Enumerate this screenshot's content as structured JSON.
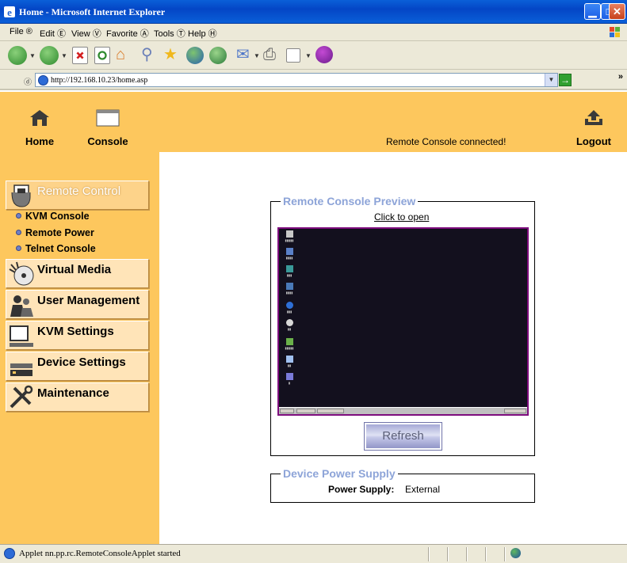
{
  "window": {
    "title": "Home - Microsoft Internet Explorer",
    "minimize": "▁",
    "maximize": "□",
    "close": "✕"
  },
  "menu": {
    "items": [
      "File ® ",
      "Edit Ⓔ ",
      "View Ⓥ ",
      "Favorite Ⓐ ",
      "Tools Ⓣ ",
      "Help Ⓗ "
    ]
  },
  "address": {
    "label": "ⓓ",
    "url": "http://192.168.10.23/home.asp",
    "go": "→",
    "more": "»"
  },
  "topnav": {
    "home": "Home",
    "console": "Console",
    "logout": "Logout",
    "status": "Remote Console connected!"
  },
  "sidebar": {
    "remote_control": "Remote Control",
    "sub_items": [
      "KVM Console",
      "Remote Power",
      "Telnet Console"
    ],
    "virtual_media": "Virtual Media",
    "user_management": "User Management",
    "kvm_settings": "KVM Settings",
    "device_settings": "Device Settings",
    "maintenance": "Maintenance"
  },
  "preview": {
    "legend": "Remote Console Preview",
    "click_to_open": "Click to open",
    "refresh": "Refresh"
  },
  "power": {
    "legend": "Device Power Supply",
    "label": "Power Supply:",
    "value": "External"
  },
  "statusbar": {
    "text": "Applet nn.pp.rc.RemoteConsoleApplet started"
  },
  "colors": {
    "page_bg": "#fdc75d",
    "menu_bg": "#ffe4b8",
    "legend": "#8da4d8",
    "preview_border": "#7d0c7d"
  }
}
